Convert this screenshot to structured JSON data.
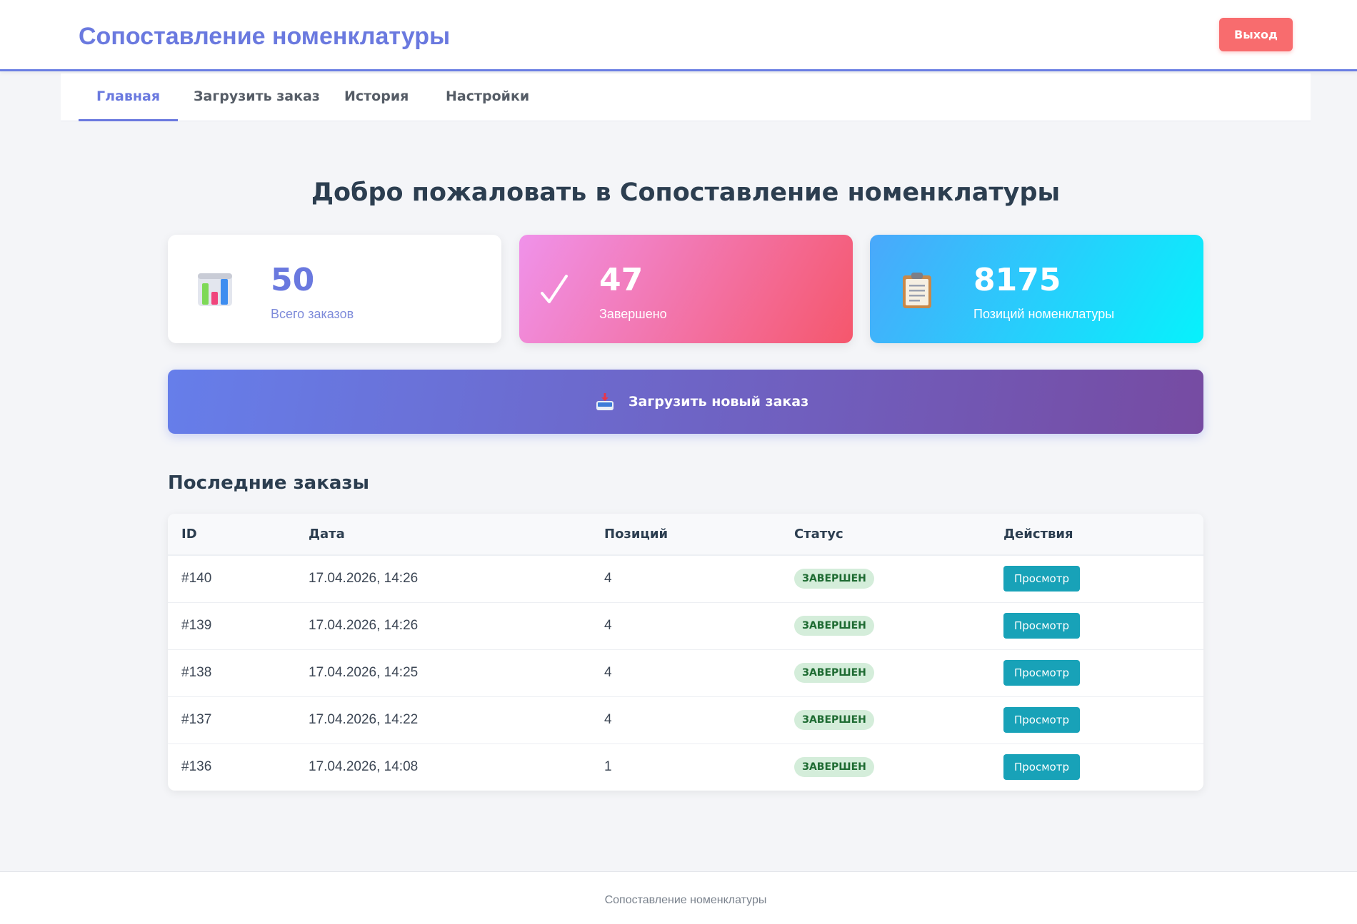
{
  "header": {
    "title": "Сопоставление номенклатуры",
    "logout_label": "Выход"
  },
  "nav": {
    "tabs": [
      {
        "label": "Главная",
        "active": true
      },
      {
        "label": "Загрузить заказ",
        "active": false
      },
      {
        "label": "История",
        "active": false
      },
      {
        "label": "Настройки",
        "active": false
      }
    ]
  },
  "main": {
    "welcome": "Добро пожаловать в Сопоставление номенклатуры",
    "stats": [
      {
        "icon": "bar-chart-icon",
        "value": "50",
        "label": "Всего заказов"
      },
      {
        "icon": "checkmark-icon",
        "value": "47",
        "label": "Завершено"
      },
      {
        "icon": "clipboard-icon",
        "value": "8175",
        "label": "Позиций номенклатуры"
      }
    ],
    "upload_button": {
      "icon": "inbox-tray-icon",
      "label": "Загрузить новый заказ"
    },
    "recent_title": "Последние заказы",
    "table": {
      "columns": [
        "ID",
        "Дата",
        "Позиций",
        "Статус",
        "Действия"
      ],
      "rows": [
        {
          "id": "#140",
          "date": "17.04.2026, 14:26",
          "positions": "4",
          "status": "ЗАВЕРШЕН",
          "action": "Просмотр"
        },
        {
          "id": "#139",
          "date": "17.04.2026, 14:26",
          "positions": "4",
          "status": "ЗАВЕРШЕН",
          "action": "Просмотр"
        },
        {
          "id": "#138",
          "date": "17.04.2026, 14:25",
          "positions": "4",
          "status": "ЗАВЕРШЕН",
          "action": "Просмотр"
        },
        {
          "id": "#137",
          "date": "17.04.2026, 14:22",
          "positions": "4",
          "status": "ЗАВЕРШЕН",
          "action": "Просмотр"
        },
        {
          "id": "#136",
          "date": "17.04.2026, 14:08",
          "positions": "1",
          "status": "ЗАВЕРШЕН",
          "action": "Просмотр"
        }
      ]
    }
  },
  "footer": {
    "text": "Сопоставление номенклатуры"
  },
  "colors": {
    "accent": "#6a79df",
    "danger": "#f86c6e",
    "info": "#18a2b8",
    "success_bg": "#d4edda",
    "success_text": "#1e6b32"
  }
}
